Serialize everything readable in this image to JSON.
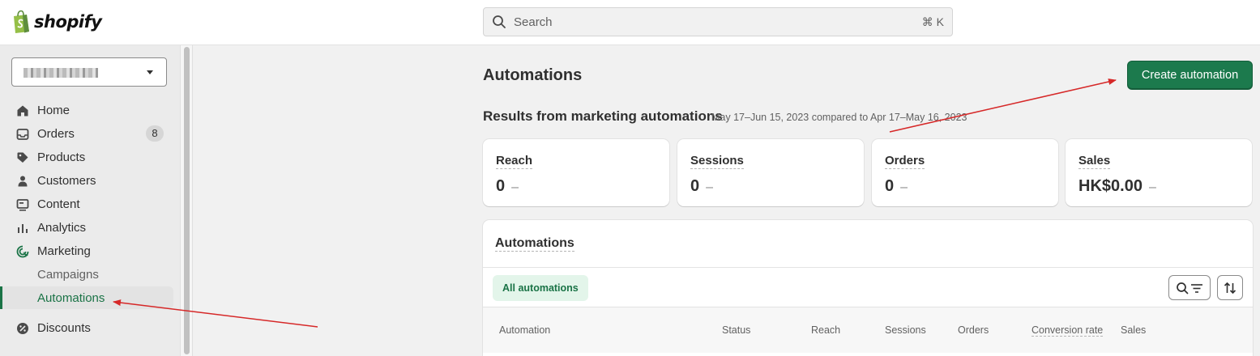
{
  "header": {
    "brand": "shopify",
    "search_placeholder": "Search",
    "search_shortcut": "⌘ K"
  },
  "sidebar": {
    "store_name": "",
    "items": [
      {
        "label": "Home",
        "icon": "home-icon"
      },
      {
        "label": "Orders",
        "icon": "inbox-icon",
        "badge": "8"
      },
      {
        "label": "Products",
        "icon": "tag-icon"
      },
      {
        "label": "Customers",
        "icon": "person-icon"
      },
      {
        "label": "Content",
        "icon": "content-icon"
      },
      {
        "label": "Analytics",
        "icon": "bar-chart-icon"
      },
      {
        "label": "Marketing",
        "icon": "target-icon"
      },
      {
        "label": "Campaigns",
        "sub": true
      },
      {
        "label": "Automations",
        "sub": true,
        "active": true
      },
      {
        "label": "Discounts",
        "icon": "discount-icon"
      }
    ]
  },
  "main": {
    "title": "Automations",
    "create_button": "Create automation",
    "results_title": "Results from marketing automations",
    "results_range": "May 17–Jun 15, 2023 compared to Apr 17–May 16, 2023",
    "metrics": [
      {
        "label": "Reach",
        "value": "0",
        "change": "–"
      },
      {
        "label": "Sessions",
        "value": "0",
        "change": "–"
      },
      {
        "label": "Orders",
        "value": "0",
        "change": "–"
      },
      {
        "label": "Sales",
        "value": "HK$0.00",
        "change": "–"
      }
    ],
    "table": {
      "title": "Automations",
      "filter_tab": "All automations",
      "columns": [
        "Automation",
        "Status",
        "Reach",
        "Sessions",
        "Orders",
        "Conversion rate",
        "Sales"
      ]
    }
  },
  "colors": {
    "accent": "#1c7a4d",
    "active_nav_text": "#1a7346",
    "annotation_arrow": "#d62828"
  }
}
